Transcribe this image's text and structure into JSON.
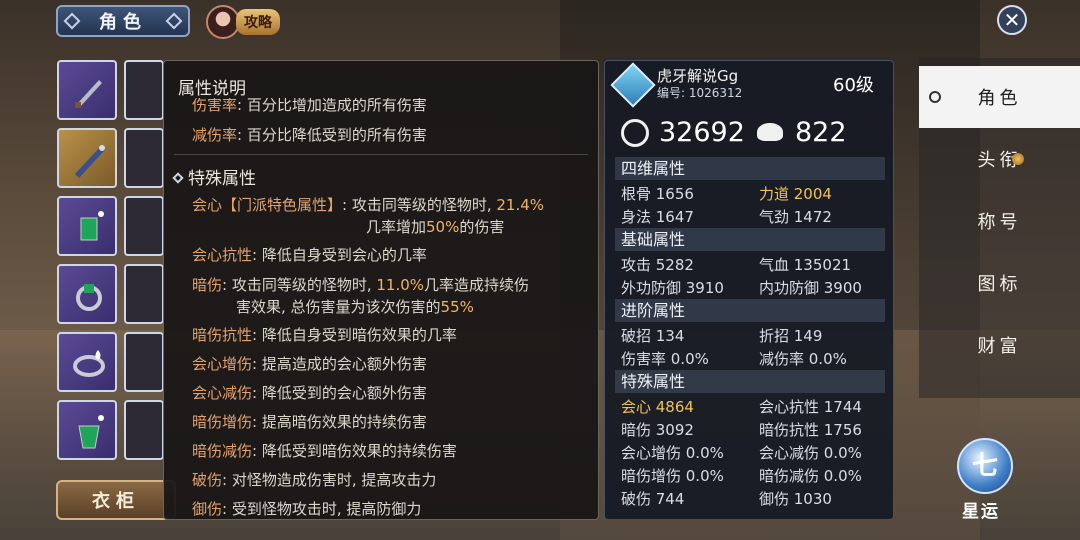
{
  "top": {
    "role_tab": "角色",
    "guide_label": "攻略"
  },
  "wardrobe_label": "衣柜",
  "desc": {
    "title": "属性说明",
    "lines_top": [
      {
        "k": "伤害率",
        "t": ": 百分比增加造成的所有伤害"
      },
      {
        "k": "减伤率",
        "t": ": 百分比降低受到的所有伤害"
      }
    ],
    "special_title": "特殊属性",
    "crit_key": "会心【门派特色属性】",
    "crit_text1": ": 攻击同等级的怪物时, ",
    "crit_pct": "21.4%",
    "crit_text2": "几率增加",
    "crit_pct2": "50%",
    "crit_text3": "的伤害",
    "crit_res": {
      "k": "会心抗性",
      "t": ": 降低自身受到会心的几率"
    },
    "dot_key": "暗伤",
    "dot_text1": ": 攻击同等级的怪物时, ",
    "dot_pct": "11.0%",
    "dot_text2": "几率造成持续伤",
    "dot_text3": "害效果, 总伤害量为该次伤害的",
    "dot_pct2": "55%",
    "more": [
      {
        "k": "暗伤抗性",
        "t": ": 降低自身受到暗伤效果的几率"
      },
      {
        "k": "会心增伤",
        "t": ": 提高造成的会心额外伤害"
      },
      {
        "k": "会心减伤",
        "t": ": 降低受到的会心额外伤害"
      },
      {
        "k": "暗伤增伤",
        "t": ": 提高暗伤效果的持续伤害"
      },
      {
        "k": "暗伤减伤",
        "t": ": 降低受到暗伤效果的持续伤害"
      },
      {
        "k": "破伤",
        "t": ": 对怪物造成伤害时, 提高攻击力"
      },
      {
        "k": "御伤",
        "t": ": 受到怪物攻击时, 提高防御力"
      }
    ]
  },
  "player": {
    "name": "虎牙解说Gg",
    "id": "编号: 1026312",
    "level": "60级",
    "power": "32692",
    "gear_score": "822"
  },
  "sections": {
    "four": "四维属性",
    "basic": "基础属性",
    "advanced": "进阶属性",
    "special": "特殊属性"
  },
  "stats": {
    "gengu": "根骨 1656",
    "lidao": "力道 2004",
    "shenfa": "身法 1647",
    "qijin": "气劲 1472",
    "attack": "攻击 5282",
    "hp": "气血 135021",
    "outer_def": "外功防御 3910",
    "inner_def": "内功防御 3900",
    "pozhao": "破招 134",
    "zhezhao": "折招 149",
    "dmg_rate": "伤害率 0.0%",
    "red_rate": "减伤率 0.0%",
    "crit": "会心 4864",
    "crit_res": "会心抗性 1744",
    "dot": "暗伤 3092",
    "dot_res": "暗伤抗性 1756",
    "crit_inc": "会心增伤 0.0%",
    "crit_red": "会心减伤 0.0%",
    "dot_inc": "暗伤增伤 0.0%",
    "dot_red": "暗伤减伤 0.0%",
    "poshang": "破伤 744",
    "yushang": "御伤 1030"
  },
  "menu": [
    "角色",
    "头衔",
    "称号",
    "图标",
    "财富"
  ],
  "seven": {
    "glyph": "七",
    "label": "星运"
  }
}
